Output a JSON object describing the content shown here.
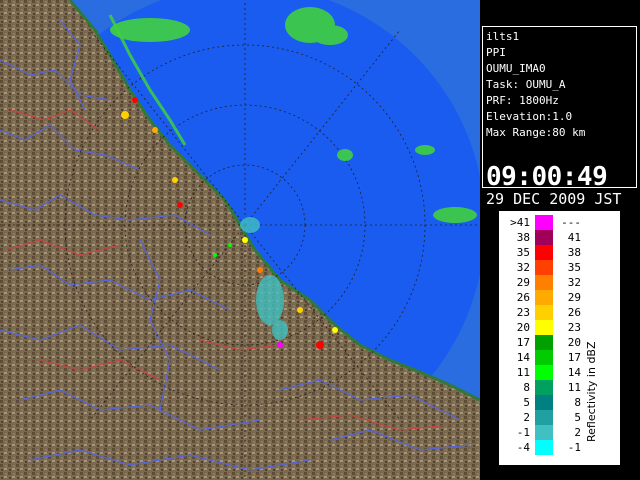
{
  "info": {
    "station": "ilts1",
    "product": "PPI",
    "site": "OUMU_IMA0",
    "task": "Task: OUMU_A",
    "prf": "PRF: 1800Hz",
    "elevation": "Elevation:1.0",
    "max_range": "Max Range:80 km",
    "time": "09:00:49",
    "date": "29 DEC 2009 JST"
  },
  "legend": {
    "title": "Reflectivity in dBZ",
    "rows": [
      {
        "lo": ">41",
        "hi": "---",
        "color": "#ff00ff"
      },
      {
        "lo": "38",
        "hi": "41",
        "color": "#a0005a"
      },
      {
        "lo": "35",
        "hi": "38",
        "color": "#ff0000"
      },
      {
        "lo": "32",
        "hi": "35",
        "color": "#ff4000"
      },
      {
        "lo": "29",
        "hi": "32",
        "color": "#ff7f00"
      },
      {
        "lo": "26",
        "hi": "29",
        "color": "#ffaa00"
      },
      {
        "lo": "23",
        "hi": "26",
        "color": "#ffd000"
      },
      {
        "lo": "20",
        "hi": "23",
        "color": "#ffff00"
      },
      {
        "lo": "17",
        "hi": "20",
        "color": "#00a000"
      },
      {
        "lo": "14",
        "hi": "17",
        "color": "#00cc00"
      },
      {
        "lo": "11",
        "hi": "14",
        "color": "#00ff00"
      },
      {
        "lo": "8",
        "hi": "11",
        "color": "#00a060"
      },
      {
        "lo": "5",
        "hi": "8",
        "color": "#008080"
      },
      {
        "lo": "2",
        "hi": "5",
        "color": "#20a0a0"
      },
      {
        "lo": "-1",
        "hi": "2",
        "color": "#40c0c0"
      },
      {
        "lo": "-4",
        "hi": "-1",
        "color": "#00ffff"
      }
    ]
  },
  "colors": {
    "sea": "#1a5cf0",
    "sea_outer": "#2a7ae8",
    "land": "#7a6a50",
    "rivers": "#5060d0",
    "echo_green": "#40d040"
  }
}
